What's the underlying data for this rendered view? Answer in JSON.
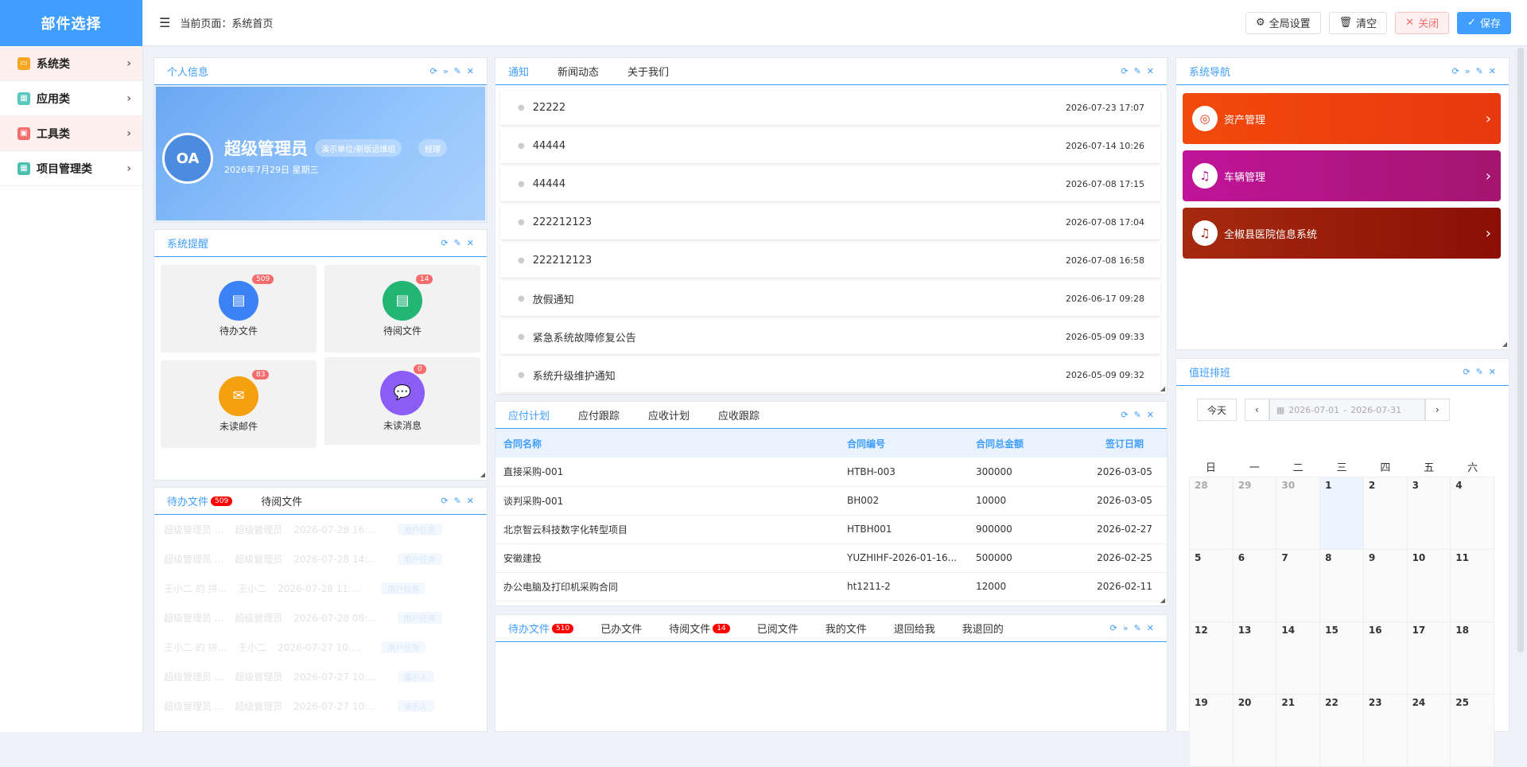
{
  "sidebar": {
    "title": "部件选择",
    "items": [
      {
        "label": "系统类",
        "color": "#f5a623"
      },
      {
        "label": "应用类",
        "color": "#5bc8c0"
      },
      {
        "label": "工具类",
        "color": "#f26d6d"
      },
      {
        "label": "项目管理类",
        "color": "#4cc0b0"
      }
    ]
  },
  "topbar": {
    "crumb": "当前页面：系统首页",
    "global_settings": "全局设置",
    "clear": "清空",
    "close": "关闭",
    "save": "保存"
  },
  "profile": {
    "title": "个人信息",
    "avatar_text": "OA",
    "name": "超级管理员",
    "tag_dept": "演示单位/新版运维组",
    "tag_role": "经理",
    "date": "2026年7月29日   星期三"
  },
  "reminders": {
    "title": "系统提醒",
    "items": [
      {
        "label": "待办文件",
        "count": "509",
        "color": "#3b82f6"
      },
      {
        "label": "待阅文件",
        "count": "14",
        "color": "#22b573"
      },
      {
        "label": "未读邮件",
        "count": "83",
        "color": "#f5a00e"
      },
      {
        "label": "未读消息",
        "count": "0",
        "color": "#8b5cf6"
      }
    ]
  },
  "docs_panel": {
    "tab_todo": "待办文件",
    "tab_todo_badge": "509",
    "tab_read": "待阅文件",
    "rows": [
      {
        "a": "超级管理员 ...",
        "b": "超级管理员",
        "c": "2026-07-28 16:...",
        "d": "用户任务"
      },
      {
        "a": "超级管理员 ...",
        "b": "超级管理员",
        "c": "2026-07-28 14:...",
        "d": "用户任务"
      },
      {
        "a": "王小二 的 拼...",
        "b": "王小二",
        "c": "2026-07-28 11:...",
        "d": "用户任务"
      },
      {
        "a": "超级管理员 ...",
        "b": "超级管理员",
        "c": "2026-07-28 08:...",
        "d": "用户任务"
      },
      {
        "a": "王小二 的 拼...",
        "b": "王小二",
        "c": "2026-07-27 10:...",
        "d": "用户任务"
      },
      {
        "a": "超级管理员 ...",
        "b": "超级管理员",
        "c": "2026-07-27 10:...",
        "d": "演示人"
      },
      {
        "a": "超级管理员 ...",
        "b": "超级管理员",
        "c": "2026-07-27 10:...",
        "d": "演示人"
      }
    ]
  },
  "notices": {
    "tabs": [
      "通知",
      "新闻动态",
      "关于我们"
    ],
    "items": [
      {
        "title": "22222",
        "time": "2026-07-23 17:07"
      },
      {
        "title": "44444",
        "time": "2026-07-14 10:26"
      },
      {
        "title": "44444",
        "time": "2026-07-08 17:15"
      },
      {
        "title": "222212123",
        "time": "2026-07-08 17:04"
      },
      {
        "title": "222212123",
        "time": "2026-07-08 16:58"
      },
      {
        "title": "放假通知",
        "time": "2026-06-17 09:28"
      },
      {
        "title": "紧急系统故障修复公告",
        "time": "2026-05-09 09:33"
      },
      {
        "title": "系统升级维护通知",
        "time": "2026-05-09 09:32"
      }
    ]
  },
  "payments": {
    "tabs": [
      "应付计划",
      "应付跟踪",
      "应收计划",
      "应收跟踪"
    ],
    "columns": [
      "合同名称",
      "合同编号",
      "合同总金额",
      "签订日期"
    ],
    "rows": [
      [
        "直接采购-001",
        "HTBH-003",
        "300000",
        "2026-03-05"
      ],
      [
        "谈判采购-001",
        "BH002",
        "10000",
        "2026-03-05"
      ],
      [
        "北京智云科技数字化转型项目",
        "HTBH001",
        "900000",
        "2026-02-27"
      ],
      [
        "安徽建投",
        "YUZHIHF-2026-01-16...",
        "500000",
        "2026-02-25"
      ],
      [
        "办公电脑及打印机采购合同",
        "ht1211-2",
        "12000",
        "2026-02-11"
      ]
    ]
  },
  "files_panel": {
    "tabs": [
      {
        "label": "待办文件",
        "badge": "510"
      },
      {
        "label": "已办文件",
        "badge": ""
      },
      {
        "label": "待阅文件",
        "badge": "14"
      },
      {
        "label": "已阅文件",
        "badge": ""
      },
      {
        "label": "我的文件",
        "badge": ""
      },
      {
        "label": "退回给我",
        "badge": ""
      },
      {
        "label": "我退回的",
        "badge": ""
      }
    ]
  },
  "sysnav": {
    "title": "系统导航",
    "items": [
      {
        "label": "资产管理",
        "color": "#ee3e0c",
        "icon": "basketball-icon"
      },
      {
        "label": "车辆管理",
        "color": "#b0168a",
        "icon": "bell-icon"
      },
      {
        "label": "全椒县医院信息系统",
        "color": "#9f1c0a",
        "icon": "bell-icon"
      }
    ]
  },
  "duty": {
    "title": "值班排班",
    "today": "今天",
    "range_start": "2026-07-01",
    "range_sep": "-",
    "range_end": "2026-07-31",
    "weekdays": [
      "日",
      "一",
      "二",
      "三",
      "四",
      "五",
      "六"
    ],
    "days": [
      "28",
      "29",
      "30",
      "1",
      "2",
      "3",
      "4",
      "5",
      "6",
      "7",
      "8",
      "9",
      "10",
      "11",
      "12",
      "13",
      "14",
      "15",
      "16",
      "17",
      "18",
      "19",
      "20",
      "21",
      "22",
      "23",
      "24",
      "25"
    ]
  }
}
